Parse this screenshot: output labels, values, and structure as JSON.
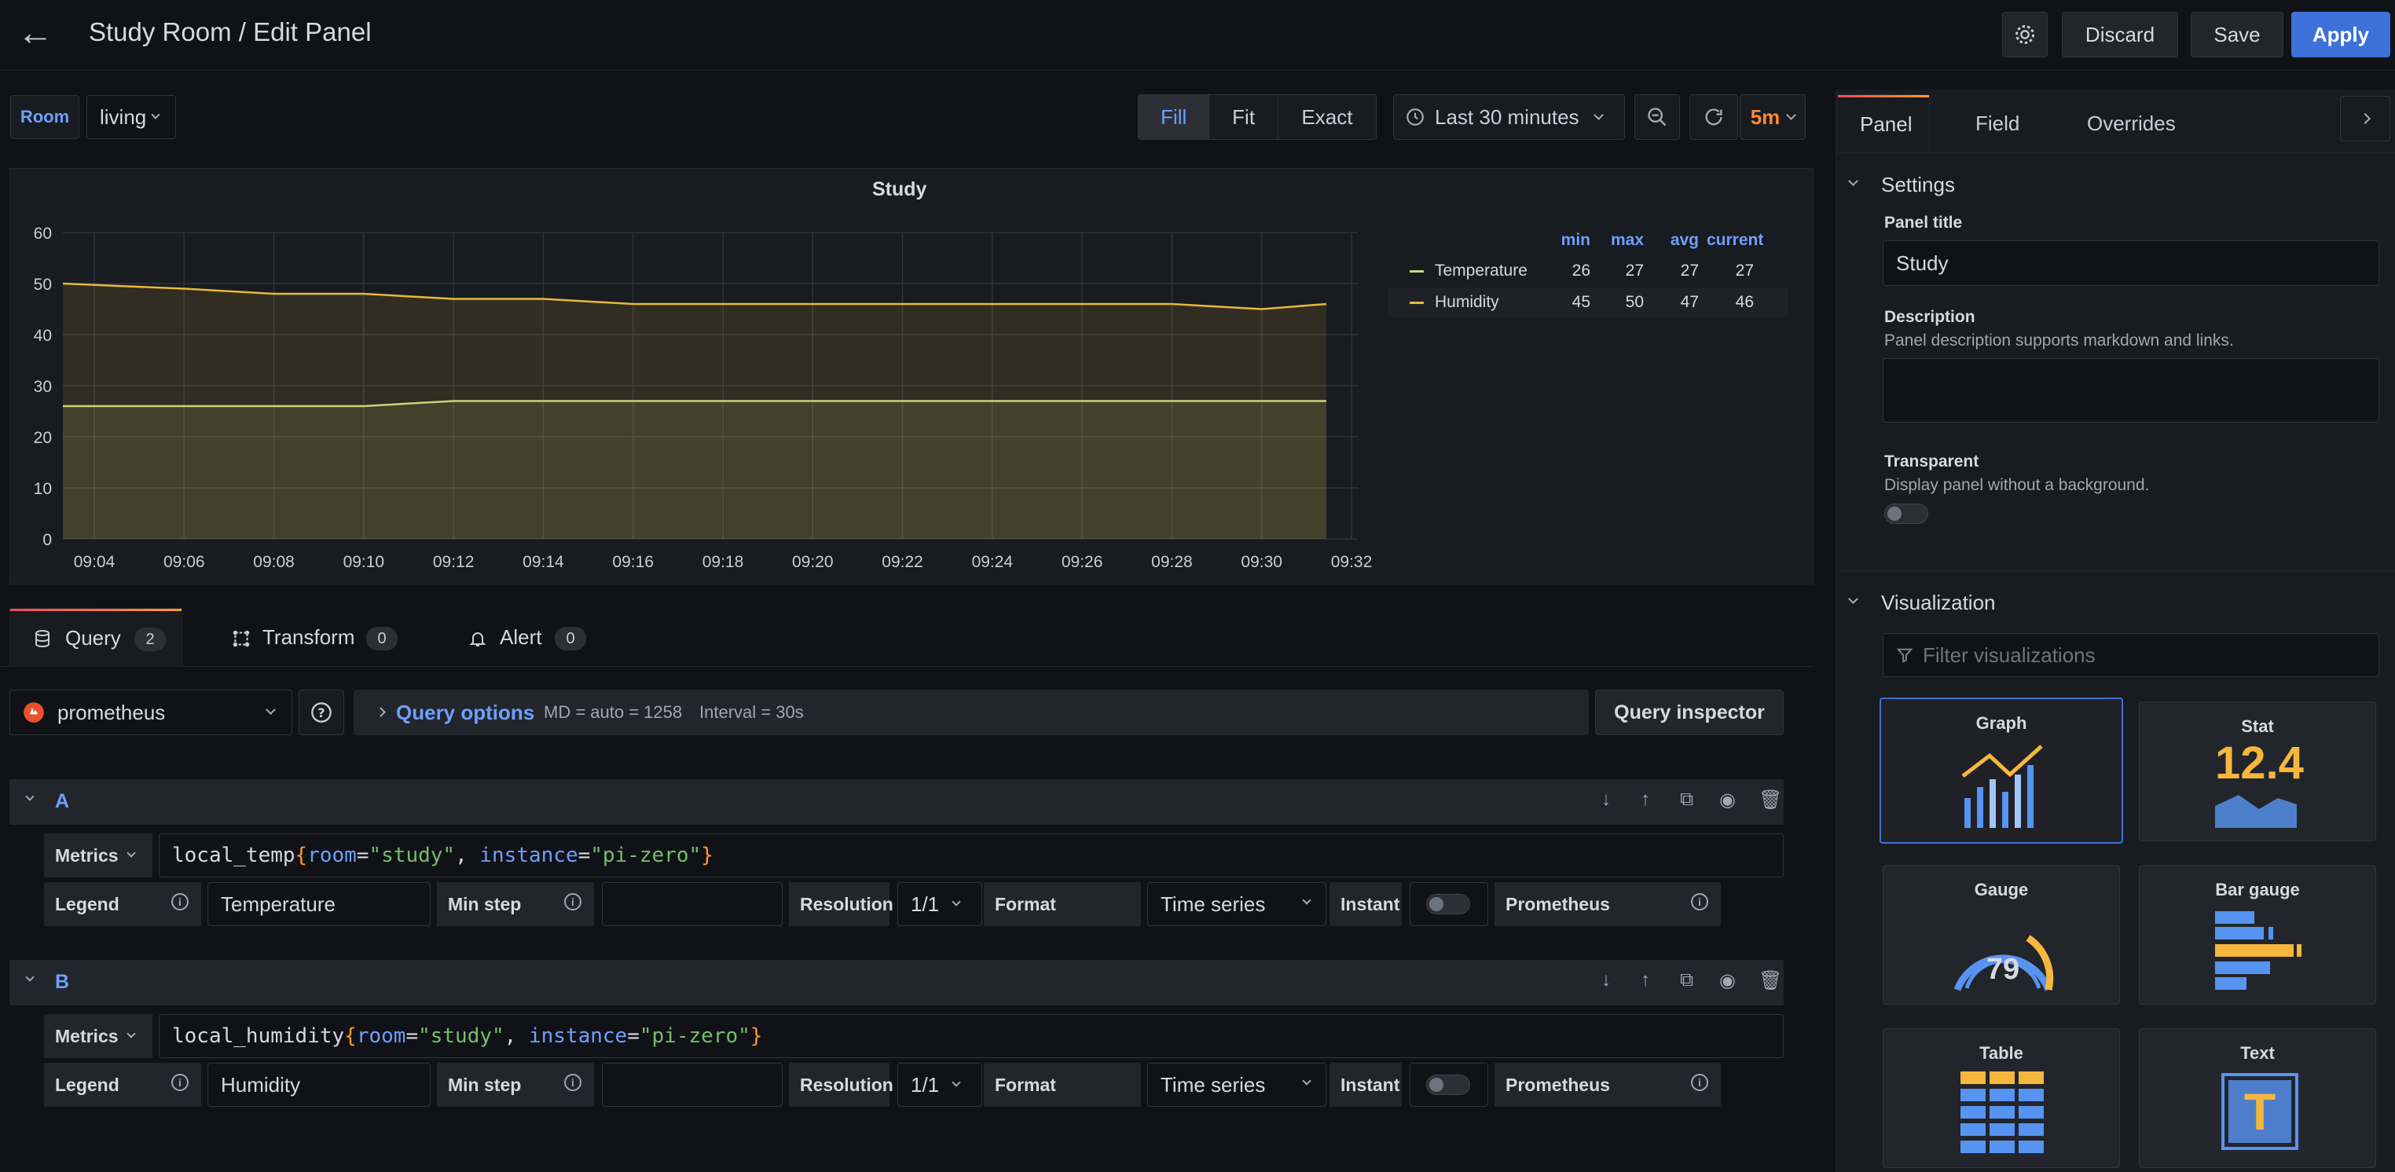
{
  "header": {
    "title": "Study Room / Edit Panel",
    "discard": "Discard",
    "save": "Save",
    "apply": "Apply"
  },
  "variables": {
    "room_label": "Room",
    "room_value": "living"
  },
  "view_modes": [
    "Fill",
    "Fit",
    "Exact"
  ],
  "time": {
    "range": "Last 30 minutes",
    "refresh": "5m"
  },
  "side_tabs": [
    "Panel",
    "Field",
    "Overrides"
  ],
  "chart_data": {
    "type": "line",
    "title": "Study",
    "x": [
      "09:04",
      "09:06",
      "09:08",
      "09:10",
      "09:12",
      "09:14",
      "09:16",
      "09:18",
      "09:20",
      "09:22",
      "09:24",
      "09:26",
      "09:28",
      "09:30",
      "09:32"
    ],
    "ylim": [
      0,
      60
    ],
    "yticks": [
      0,
      10,
      20,
      30,
      40,
      50,
      60
    ],
    "grid": true,
    "legend_columns": [
      "min",
      "max",
      "avg",
      "current"
    ],
    "legend_placement": "right",
    "series": [
      {
        "name": "Temperature",
        "color": "#c8d980",
        "values": [
          26,
          26,
          26,
          26,
          27,
          27,
          27,
          27,
          27,
          27,
          27,
          27,
          27,
          27,
          27
        ],
        "stats": [
          "26",
          "27",
          "27",
          "27"
        ]
      },
      {
        "name": "Humidity",
        "color": "#eab839",
        "values": [
          50,
          49,
          48,
          48,
          47,
          47,
          46,
          46,
          46,
          46,
          46,
          46,
          46,
          45,
          46
        ],
        "stats": [
          "45",
          "50",
          "47",
          "46"
        ]
      }
    ]
  },
  "query_tabs": [
    {
      "label": "Query",
      "count": "2"
    },
    {
      "label": "Transform",
      "count": "0"
    },
    {
      "label": "Alert",
      "count": "0"
    }
  ],
  "datasource": "prometheus",
  "query_options": {
    "label": "Query options",
    "md": "MD = auto = 1258",
    "interval": "Interval = 30s",
    "inspector": "Query inspector"
  },
  "queries": [
    {
      "ref": "A",
      "metric_name": "local_temp",
      "label1_key": "room",
      "label1_val": "\"study\"",
      "label2_key": "instance",
      "label2_val": "\"pi-zero\"",
      "legend": "Temperature"
    },
    {
      "ref": "B",
      "metric_name": "local_humidity",
      "label1_key": "room",
      "label1_val": "\"study\"",
      "label2_key": "instance",
      "label2_val": "\"pi-zero\"",
      "legend": "Humidity"
    }
  ],
  "query_labels": {
    "metrics": "Metrics",
    "legend": "Legend",
    "min_step": "Min step",
    "resolution": "Resolution",
    "resolution_val": "1/1",
    "format": "Format",
    "format_val": "Time series",
    "instant": "Instant",
    "prometheus": "Prometheus"
  },
  "settings": {
    "section": "Settings",
    "panel_title_label": "Panel title",
    "panel_title": "Study",
    "description_label": "Description",
    "description_help": "Panel description supports markdown and links.",
    "transparent_label": "Transparent",
    "transparent_help": "Display panel without a background."
  },
  "visualization": {
    "section": "Visualization",
    "filter_placeholder": "Filter visualizations",
    "items": [
      "Graph",
      "Stat",
      "Gauge",
      "Bar gauge",
      "Table",
      "Text"
    ],
    "stat_value": "12.4",
    "gauge_value": "79",
    "text_glyph": "T"
  }
}
